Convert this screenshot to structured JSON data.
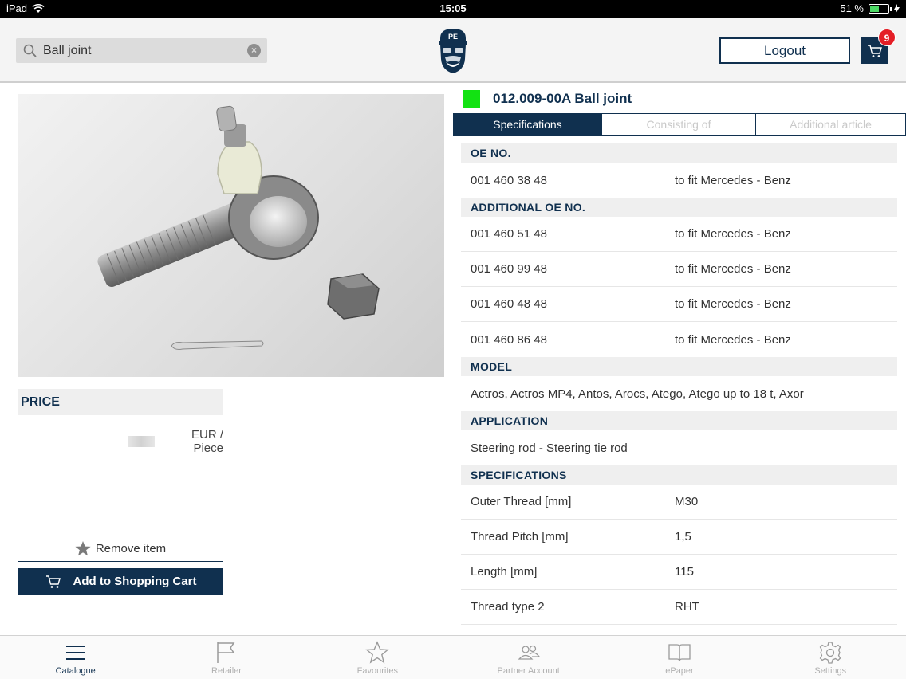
{
  "status_bar": {
    "device": "iPad",
    "time": "15:05",
    "battery": "51 %",
    "battery_level": 0.51
  },
  "header": {
    "search": {
      "value": "Ball joint",
      "placeholder": ""
    },
    "logo_text": "PE",
    "logout_label": "Logout",
    "cart_count": "9"
  },
  "product": {
    "title": "012.009-00A Ball joint",
    "status_color": "#12e212"
  },
  "tabs": [
    {
      "label": "Specifications",
      "active": true
    },
    {
      "label": "Consisting of",
      "active": false
    },
    {
      "label": "Additional article",
      "active": false
    }
  ],
  "price": {
    "heading": "PRICE",
    "unit": "EUR / Piece"
  },
  "actions": {
    "remove_label": "Remove item",
    "add_label": "Add to Shopping Cart"
  },
  "sections": {
    "oe_no": {
      "heading": "OE NO.",
      "rows": [
        {
          "number": "001 460 38 48",
          "fit": "to fit Mercedes - Benz"
        }
      ]
    },
    "additional_oe_no": {
      "heading": "ADDITIONAL OE NO.",
      "rows": [
        {
          "number": "001 460 51 48",
          "fit": "to fit Mercedes - Benz"
        },
        {
          "number": "001 460 99 48",
          "fit": "to fit Mercedes - Benz"
        },
        {
          "number": "001 460 48 48",
          "fit": "to fit Mercedes - Benz"
        },
        {
          "number": "001 460 86 48",
          "fit": "to fit Mercedes - Benz"
        }
      ]
    },
    "model": {
      "heading": "MODEL",
      "text": "Actros, Actros MP4, Antos, Arocs, Atego, Atego up to 18 t, Axor"
    },
    "application": {
      "heading": "APPLICATION",
      "text": "Steering rod - Steering tie rod"
    },
    "specifications": {
      "heading": "SPECIFICATIONS",
      "rows": [
        {
          "name": "Outer Thread [mm]",
          "value": "M30"
        },
        {
          "name": "Thread Pitch [mm]",
          "value": "1,5"
        },
        {
          "name": "Length [mm]",
          "value": "115"
        },
        {
          "name": "Thread type 2",
          "value": "RHT"
        }
      ]
    }
  },
  "tabbar": [
    {
      "label": "Catalogue",
      "icon": "menu-icon",
      "active": true
    },
    {
      "label": "Retailer",
      "icon": "flag-icon",
      "active": false
    },
    {
      "label": "Favourites",
      "icon": "star-icon",
      "active": false
    },
    {
      "label": "Partner Account",
      "icon": "people-icon",
      "active": false
    },
    {
      "label": "ePaper",
      "icon": "book-icon",
      "active": false
    },
    {
      "label": "Settings",
      "icon": "gear-icon",
      "active": false
    }
  ],
  "colors": {
    "brand": "#10304f",
    "badge": "#e41e26",
    "section_bg": "#efefef"
  }
}
